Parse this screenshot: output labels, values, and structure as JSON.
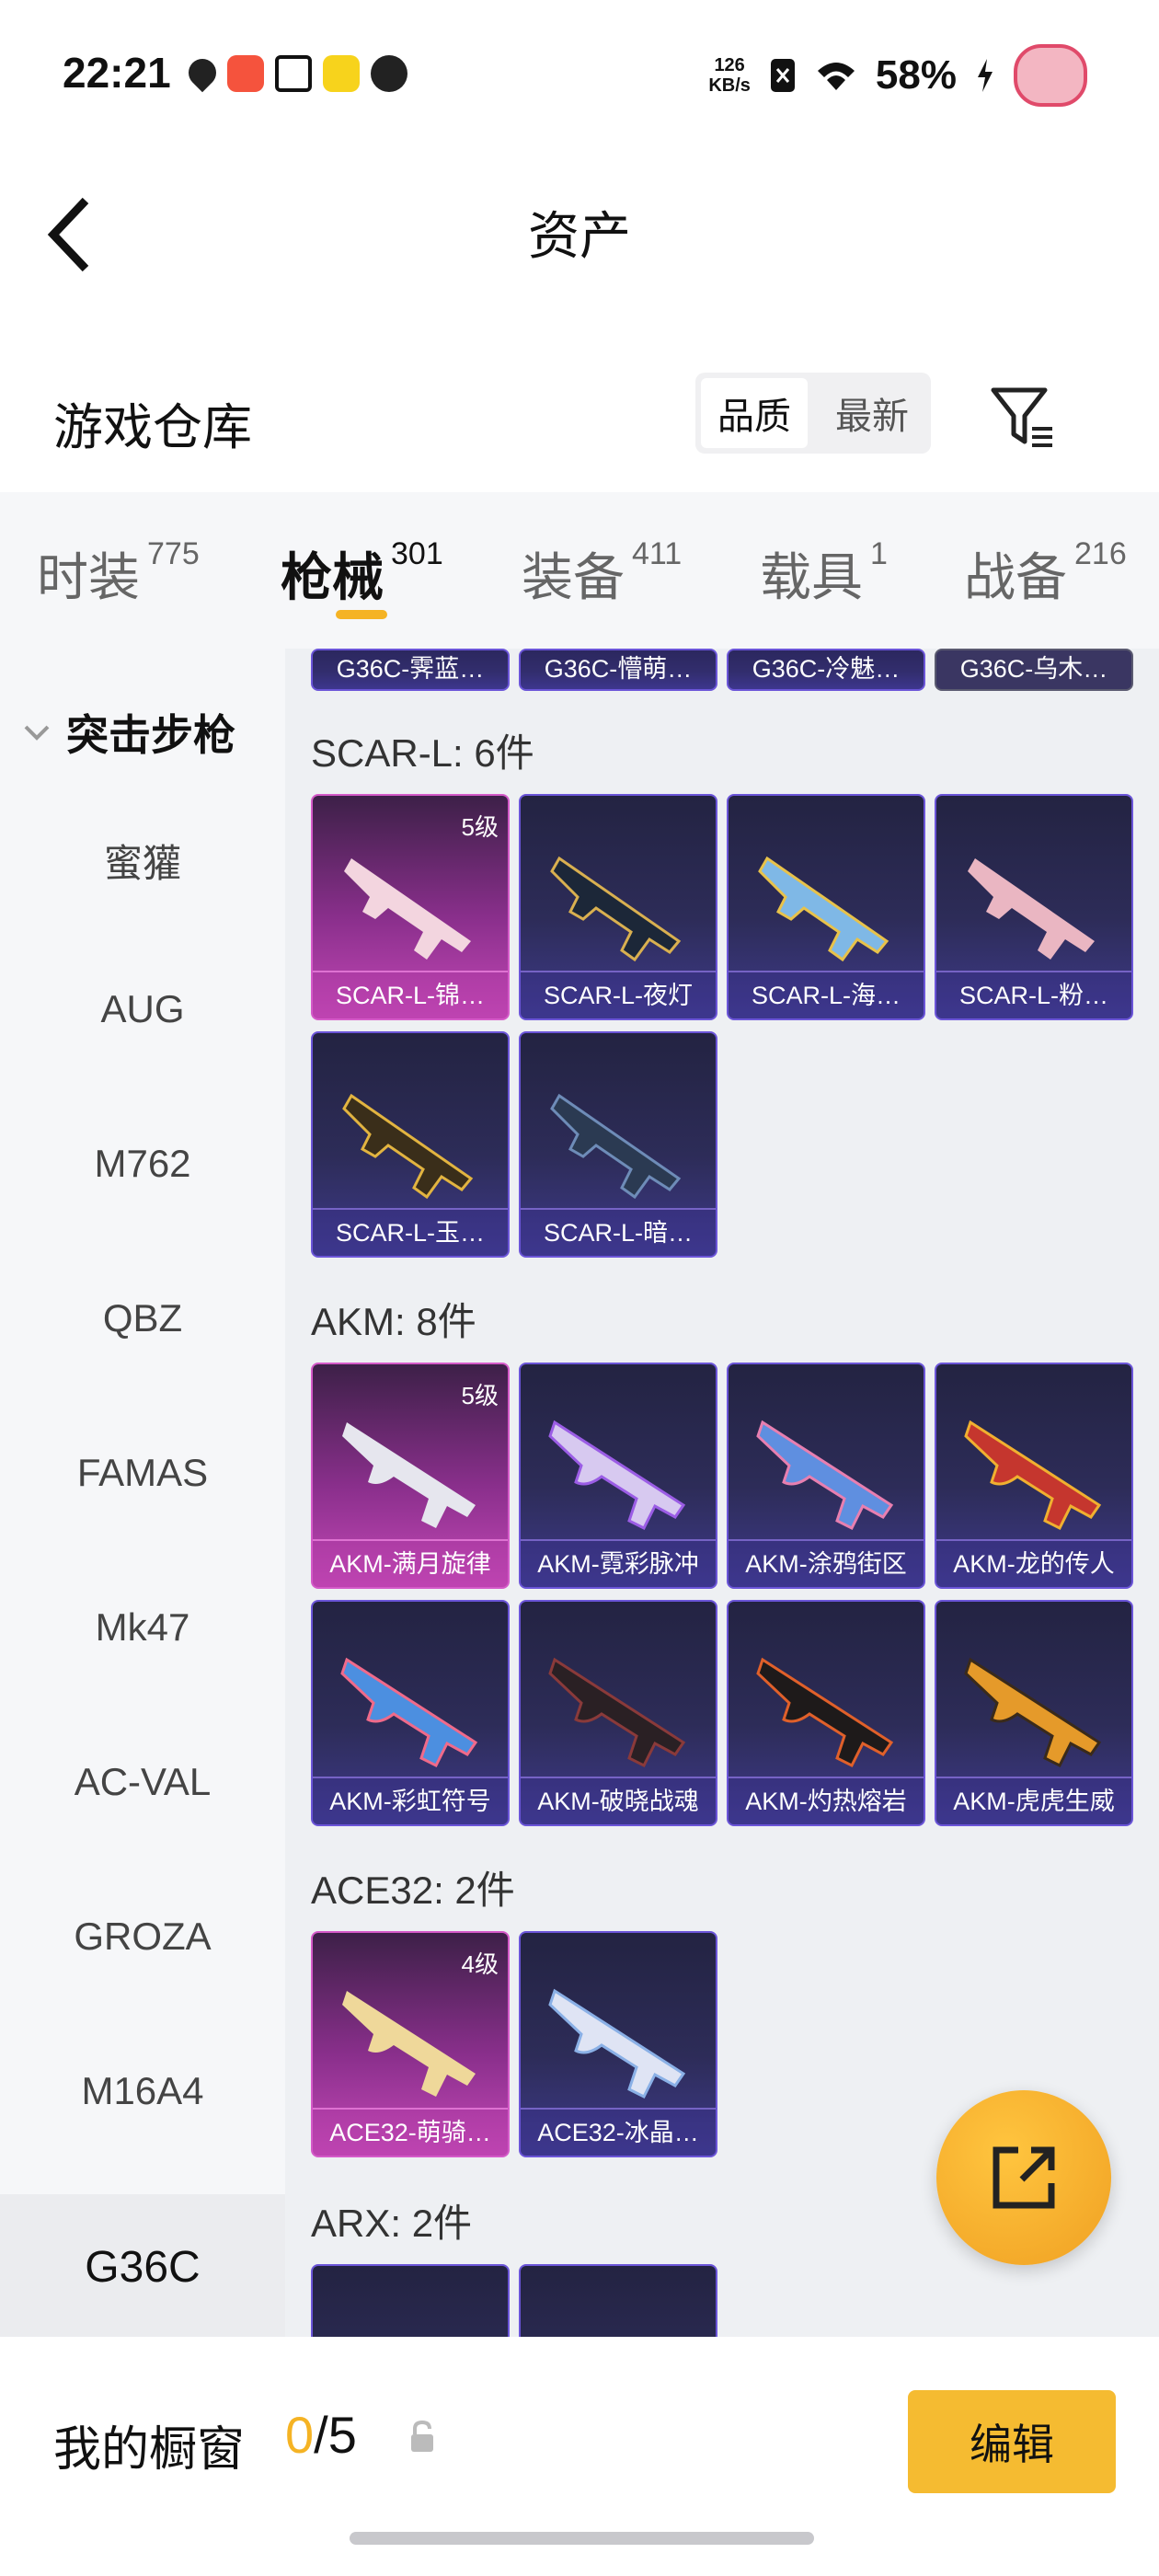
{
  "status_bar": {
    "time": "22:21",
    "net_speed_value": "126",
    "net_speed_unit": "KB/s",
    "battery": "58%"
  },
  "header": {
    "title": "资产"
  },
  "section": {
    "heading": "游戏仓库",
    "sort_options": [
      "品质",
      "最新"
    ],
    "active_sort": "品质"
  },
  "tabs": [
    {
      "label": "时装",
      "count": "775"
    },
    {
      "label": "枪械",
      "count": "301",
      "active": true
    },
    {
      "label": "装备",
      "count": "411"
    },
    {
      "label": "载具",
      "count": "1"
    },
    {
      "label": "战备",
      "count": "216"
    }
  ],
  "sidebar": {
    "category": "突击步枪",
    "items": [
      "蜜獾",
      "AUG",
      "M762",
      "QBZ",
      "FAMAS",
      "Mk47",
      "AC-VAL",
      "GROZA",
      "M16A4",
      "G36C"
    ],
    "active": "G36C"
  },
  "groups": [
    {
      "title": "",
      "items": [
        {
          "name": "G36C-霁蓝…",
          "level": ""
        },
        {
          "name": "G36C-懵萌…",
          "level": ""
        },
        {
          "name": "G36C-冷魅…",
          "level": ""
        },
        {
          "name": "G36C-乌木…",
          "level": ""
        }
      ]
    },
    {
      "title": "SCAR-L: 6件",
      "items": [
        {
          "name": "SCAR-L-锦…",
          "level": "5级"
        },
        {
          "name": "SCAR-L-夜灯",
          "level": ""
        },
        {
          "name": "SCAR-L-海…",
          "level": ""
        },
        {
          "name": "SCAR-L-粉…",
          "level": ""
        },
        {
          "name": "SCAR-L-玉…",
          "level": ""
        },
        {
          "name": "SCAR-L-暗…",
          "level": ""
        }
      ]
    },
    {
      "title": "AKM: 8件",
      "items": [
        {
          "name": "AKM-满月旋律",
          "level": "5级"
        },
        {
          "name": "AKM-霓彩脉冲",
          "level": ""
        },
        {
          "name": "AKM-涂鸦街区",
          "level": ""
        },
        {
          "name": "AKM-龙的传人",
          "level": ""
        },
        {
          "name": "AKM-彩虹符号",
          "level": ""
        },
        {
          "name": "AKM-破晓战魂",
          "level": ""
        },
        {
          "name": "AKM-灼热熔岩",
          "level": ""
        },
        {
          "name": "AKM-虎虎生威",
          "level": ""
        }
      ]
    },
    {
      "title": "ACE32: 2件",
      "items": [
        {
          "name": "ACE32-萌骑…",
          "level": "4级"
        },
        {
          "name": "ACE32-冰晶…",
          "level": ""
        }
      ]
    },
    {
      "title": "ARX: 2件",
      "items": []
    }
  ],
  "showcase": {
    "label": "我的橱窗",
    "current": "0",
    "total": "/5",
    "edit_label": "编辑"
  },
  "colors": {
    "accent": "#f5b324",
    "card_base": "#2d2c58",
    "card_premium": "#c448b6"
  }
}
